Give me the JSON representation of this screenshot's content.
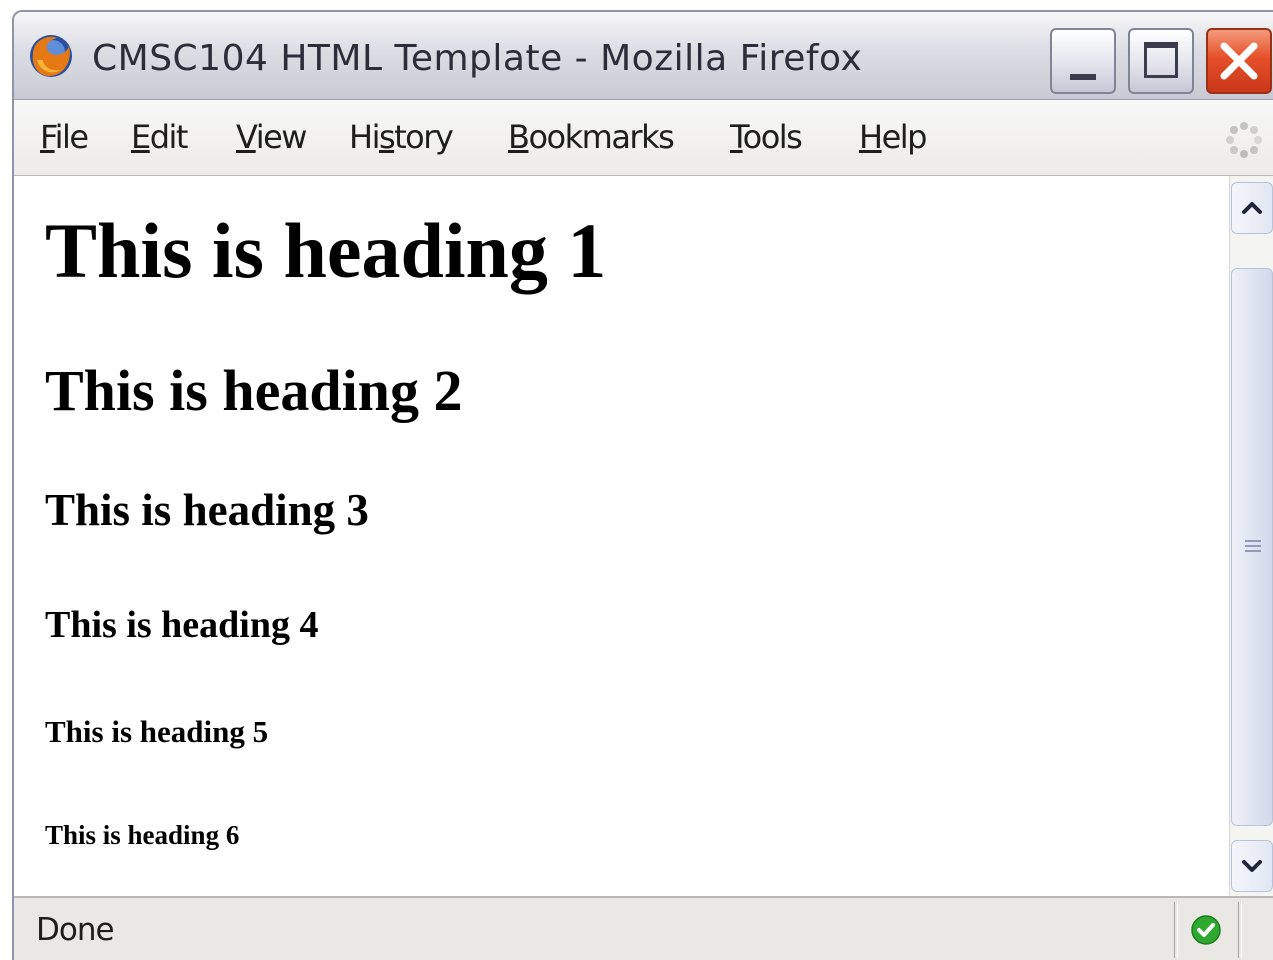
{
  "window": {
    "title": "CMSC104 HTML Template - Mozilla Firefox"
  },
  "menu": {
    "file": {
      "pre": "",
      "key": "F",
      "post": "ile"
    },
    "edit": {
      "pre": "",
      "key": "E",
      "post": "dit"
    },
    "view": {
      "pre": "",
      "key": "V",
      "post": "iew"
    },
    "history": {
      "pre": "Hi",
      "key": "s",
      "post": "tory"
    },
    "bookmarks": {
      "pre": "",
      "key": "B",
      "post": "ookmarks"
    },
    "tools": {
      "pre": "",
      "key": "T",
      "post": "ools"
    },
    "help": {
      "pre": "",
      "key": "H",
      "post": "elp"
    }
  },
  "content": {
    "h1": "This is heading 1",
    "h2": "This is heading 2",
    "h3": "This is heading 3",
    "h4": "This is heading 4",
    "h5": "This is heading 5",
    "h6": "This is heading 6"
  },
  "status": {
    "text": "Done"
  },
  "icons": {
    "app": "firefox-icon",
    "minimize": "minimize-icon",
    "maximize": "maximize-icon",
    "close": "close-icon",
    "throbber": "throbber-icon",
    "scroll_up": "chevron-up-icon",
    "scroll_down": "chevron-down-icon",
    "status_ok": "checkmark-icon"
  },
  "colors": {
    "close_button": "#e5502a",
    "status_ok": "#2ea82e"
  }
}
